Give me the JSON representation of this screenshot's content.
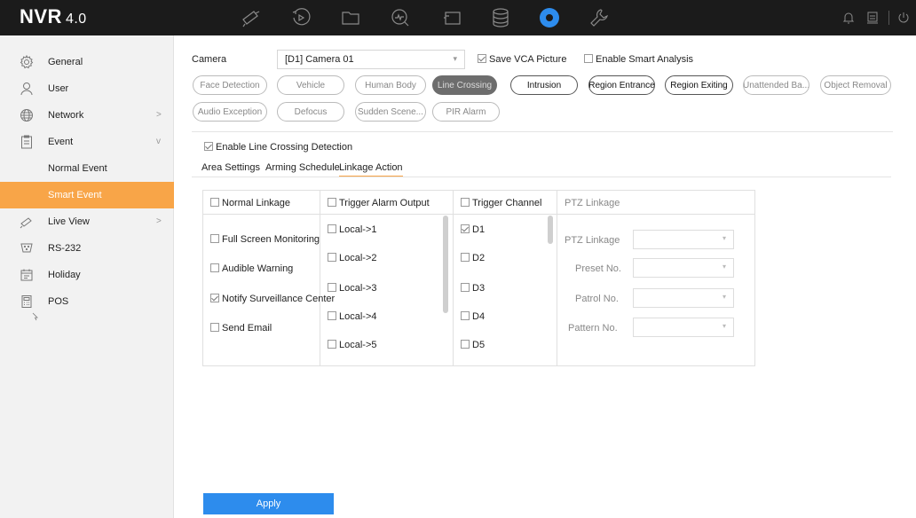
{
  "app": {
    "logo": "NVR",
    "version": "4.0"
  },
  "topnav": {
    "icons": [
      "live-view-icon",
      "playback-icon",
      "file-management-icon",
      "smart-analysis-icon",
      "manual-recording-icon",
      "storage-icon",
      "configuration-icon",
      "maintenance-icon"
    ],
    "active": "configuration-icon",
    "right_icons": [
      "notification-icon",
      "account-icon",
      "power-icon"
    ]
  },
  "sidebar": {
    "items": [
      {
        "label": "General",
        "icon": "general-gear-icon"
      },
      {
        "label": "User",
        "icon": "user-icon"
      },
      {
        "label": "Network",
        "icon": "globe-icon",
        "chevron": ">"
      },
      {
        "label": "Event",
        "icon": "clipboard-icon",
        "chevron": "v"
      },
      {
        "label": "Normal Event"
      },
      {
        "label": "Smart Event"
      },
      {
        "label": "Live View",
        "icon": "camera-icon",
        "chevron": ">"
      },
      {
        "label": "RS-232",
        "icon": "serial-port-icon"
      },
      {
        "label": "Holiday",
        "icon": "calendar-icon"
      },
      {
        "label": "POS",
        "icon": "pos-terminal-icon"
      }
    ],
    "active": "Smart Event"
  },
  "camera": {
    "label": "Camera",
    "value": "[D1] Camera 01"
  },
  "save_vca": {
    "label": "Save VCA Picture",
    "checked": true
  },
  "enable_smart": {
    "label": "Enable Smart Analysis",
    "checked": false
  },
  "smart_events": [
    "Face Detection",
    "Vehicle",
    "Human Body",
    "Line Crossing",
    "Intrusion",
    "Region Entrance",
    "Region Exiting",
    "Unattended Ba...",
    "Object Removal",
    "Audio Exception",
    "Defocus",
    "Sudden Scene...",
    "PIR Alarm"
  ],
  "active_event": "Line Crossing",
  "enable_detection": {
    "label": "Enable Line Crossing Detection",
    "checked": true
  },
  "tabs": [
    "Area Settings",
    "Arming Schedule",
    "Linkage Action"
  ],
  "active_tab": "Linkage Action",
  "linkage": {
    "normal": {
      "header": "Normal Linkage",
      "items": [
        {
          "label": "Full Screen Monitoring",
          "checked": false
        },
        {
          "label": "Audible Warning",
          "checked": false
        },
        {
          "label": "Notify Surveillance Center",
          "checked": true
        },
        {
          "label": "Send Email",
          "checked": false
        }
      ]
    },
    "alarm_output": {
      "header": "Trigger Alarm Output",
      "items": [
        "Local->1",
        "Local->2",
        "Local->3",
        "Local->4",
        "Local->5"
      ]
    },
    "channel": {
      "header": "Trigger Channel",
      "items": [
        {
          "label": "D1",
          "checked": true
        },
        {
          "label": "D2",
          "checked": false
        },
        {
          "label": "D3",
          "checked": false
        },
        {
          "label": "D4",
          "checked": false
        },
        {
          "label": "D5",
          "checked": false
        }
      ]
    },
    "ptz": {
      "header": "PTZ Linkage",
      "fields": [
        "PTZ Linkage",
        "Preset No.",
        "Patrol No.",
        "Pattern No."
      ]
    }
  },
  "apply_label": "Apply"
}
